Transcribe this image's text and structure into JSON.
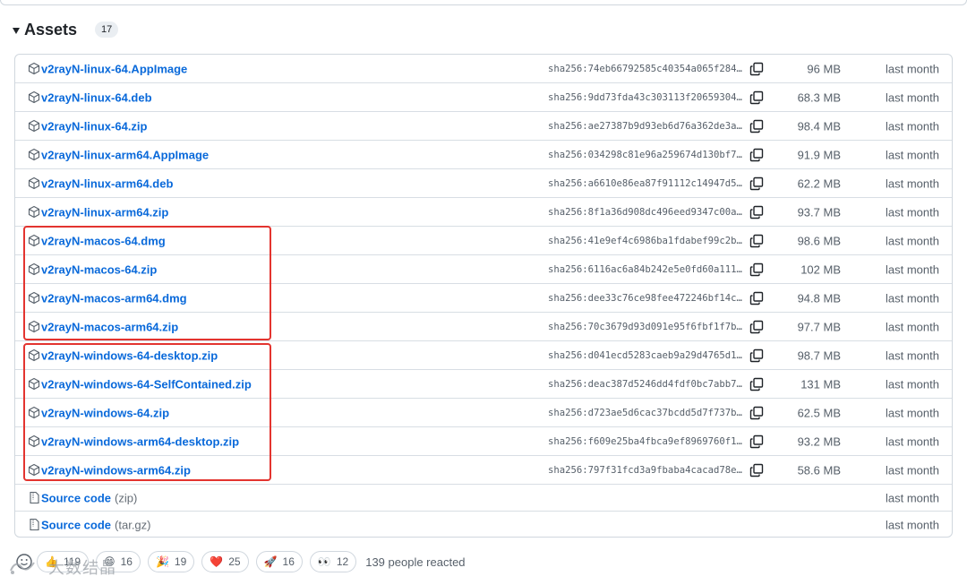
{
  "assets": {
    "title": "Assets",
    "count": "17",
    "files": [
      {
        "name": "v2rayN-linux-64.AppImage",
        "sha": "sha256:74eb66792585c40354a065f284…",
        "size": "96 MB",
        "date": "last month"
      },
      {
        "name": "v2rayN-linux-64.deb",
        "sha": "sha256:9dd73fda43c303113f20659304…",
        "size": "68.3 MB",
        "date": "last month"
      },
      {
        "name": "v2rayN-linux-64.zip",
        "sha": "sha256:ae27387b9d93eb6d76a362de3a…",
        "size": "98.4 MB",
        "date": "last month"
      },
      {
        "name": "v2rayN-linux-arm64.AppImage",
        "sha": "sha256:034298c81e96a259674d130bf7…",
        "size": "91.9 MB",
        "date": "last month"
      },
      {
        "name": "v2rayN-linux-arm64.deb",
        "sha": "sha256:a6610e86ea87f91112c14947d5…",
        "size": "62.2 MB",
        "date": "last month"
      },
      {
        "name": "v2rayN-linux-arm64.zip",
        "sha": "sha256:8f1a36d908dc496eed9347c00a…",
        "size": "93.7 MB",
        "date": "last month"
      },
      {
        "name": "v2rayN-macos-64.dmg",
        "sha": "sha256:41e9ef4c6986ba1fdabef99c2b…",
        "size": "98.6 MB",
        "date": "last month"
      },
      {
        "name": "v2rayN-macos-64.zip",
        "sha": "sha256:6116ac6a84b242e5e0fd60a111…",
        "size": "102 MB",
        "date": "last month"
      },
      {
        "name": "v2rayN-macos-arm64.dmg",
        "sha": "sha256:dee33c76ce98fee472246bf14c…",
        "size": "94.8 MB",
        "date": "last month"
      },
      {
        "name": "v2rayN-macos-arm64.zip",
        "sha": "sha256:70c3679d93d091e95f6fbf1f7b…",
        "size": "97.7 MB",
        "date": "last month"
      },
      {
        "name": "v2rayN-windows-64-desktop.zip",
        "sha": "sha256:d041ecd5283caeb9a29d4765d1…",
        "size": "98.7 MB",
        "date": "last month"
      },
      {
        "name": "v2rayN-windows-64-SelfContained.zip",
        "sha": "sha256:deac387d5246dd4fdf0bc7abb7…",
        "size": "131 MB",
        "date": "last month"
      },
      {
        "name": "v2rayN-windows-64.zip",
        "sha": "sha256:d723ae5d6cac37bcdd5d7f737b…",
        "size": "62.5 MB",
        "date": "last month"
      },
      {
        "name": "v2rayN-windows-arm64-desktop.zip",
        "sha": "sha256:f609e25ba4fbca9ef8969760f1…",
        "size": "93.2 MB",
        "date": "last month"
      },
      {
        "name": "v2rayN-windows-arm64.zip",
        "sha": "sha256:797f31fcd3a9fbaba4cacad78e…",
        "size": "58.6 MB",
        "date": "last month"
      }
    ],
    "sources": [
      {
        "label": "Source code",
        "ext": "(zip)",
        "date": "last month"
      },
      {
        "label": "Source code",
        "ext": "(tar.gz)",
        "date": "last month"
      }
    ]
  },
  "reactions": {
    "items": [
      {
        "emoji": "👍",
        "count": "119"
      },
      {
        "emoji": "😄",
        "count": "16"
      },
      {
        "emoji": "🎉",
        "count": "19"
      },
      {
        "emoji": "❤️",
        "count": "25"
      },
      {
        "emoji": "🚀",
        "count": "16"
      },
      {
        "emoji": "👀",
        "count": "12"
      }
    ],
    "summary": "139 people reacted"
  },
  "watermark": {
    "text": "大数结晶"
  },
  "colors": {
    "link": "#0969da",
    "highlight": "#e3342f",
    "border": "#d0d7de",
    "muted": "#57606a"
  }
}
